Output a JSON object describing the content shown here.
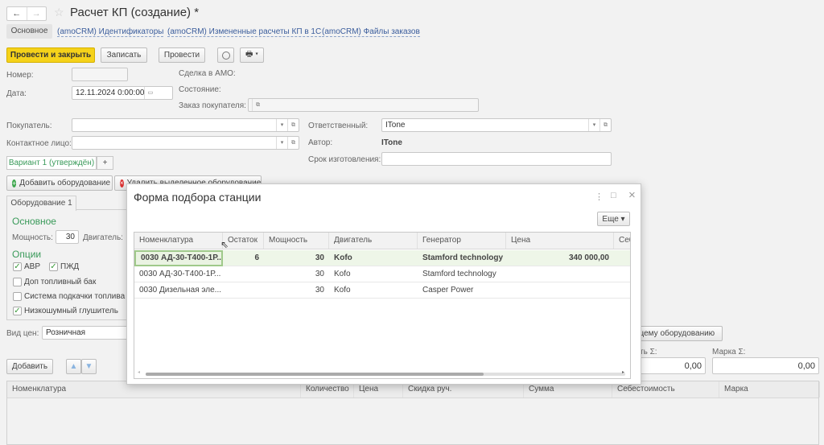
{
  "window": {
    "title": "Расчет КП (создание) *",
    "back": "←",
    "forward": "→",
    "star": "☆"
  },
  "tabs": [
    {
      "label": "Основное"
    },
    {
      "label": "(amoCRM) Идентификаторы"
    },
    {
      "label": "(amoCRM) Измененные расчеты КП в 1С"
    },
    {
      "label": "(amoCRM) Файлы заказов"
    }
  ],
  "toolbar": {
    "post_close": "Провести и закрыть",
    "save": "Записать",
    "post": "Провести",
    "print_icon": "printer-icon",
    "accent": "#f5d21a"
  },
  "form": {
    "number_label": "Номер:",
    "number_value": "",
    "date_label": "Дата:",
    "date_value": "12.11.2024  0:00:00",
    "deal_label": "Сделка в АМО:",
    "state_label": "Состояние:",
    "order_label": "Заказ покупателя:",
    "order_value": "",
    "buyer_label": "Покупатель:",
    "buyer_value": "",
    "contact_label": "Контактное лицо:",
    "contact_value": "",
    "responsible_label": "Ответственный:",
    "responsible_value": "ITone",
    "author_label": "Автор:",
    "author_value": "ITone",
    "term_label": "Срок изготовления:",
    "term_value": ""
  },
  "variant": {
    "tab": "Вариант 1 (утверждён)",
    "add": "+"
  },
  "equipment": {
    "add": "Добавить оборудование",
    "delete": "Удалить выделенное оборудование",
    "tab": "Оборудование 1",
    "main_header": "Основное",
    "power_label": "Мощность:",
    "power_value": "30",
    "engine_label": "Двигатель:",
    "options_header": "Опции",
    "options": [
      {
        "label": "АВР",
        "checked": true
      },
      {
        "label": "ПЖД",
        "checked": true
      },
      {
        "label": "Доп топливный бак",
        "checked": false
      },
      {
        "label": "Система подкачки топлива",
        "checked": false
      },
      {
        "label": "Низкошумный глушитель",
        "checked": true
      }
    ]
  },
  "price_type": {
    "label": "Вид цен:",
    "value": "Розничная"
  },
  "right_panel": {
    "button": "щему оборудованию",
    "cost_label": "сть Σ:",
    "cost_value": "0,00",
    "margin_label": "Марка Σ:",
    "margin_value": "0,00"
  },
  "bottom": {
    "add": "Добавить",
    "columns": [
      "Номенклатура",
      "Количество",
      "Цена",
      "Скидка руч.",
      "Сумма",
      "Себестоимость",
      "Марка"
    ]
  },
  "modal": {
    "title": "Форма подбора станции",
    "more": "Еще ▾",
    "menu": "⋮",
    "maximize": "□",
    "close": "×",
    "columns": [
      "Номенклатура",
      "Остаток",
      "Мощность",
      "Двигатель",
      "Генератор",
      "Цена",
      "Себ"
    ],
    "rows": [
      [
        "0030 АД-30-Т400-1Р...",
        "6",
        "30",
        "Kofo",
        "Stamford technology",
        "340 000,00"
      ],
      [
        "0030 АД-30-Т400-1Р...",
        "",
        "30",
        "Kofo",
        "Stamford technology",
        ""
      ],
      [
        "0030 Дизельная эле...",
        "",
        "30",
        "Kofo",
        "Casper Power",
        ""
      ]
    ],
    "selected_row_color": "#eef6e8"
  }
}
